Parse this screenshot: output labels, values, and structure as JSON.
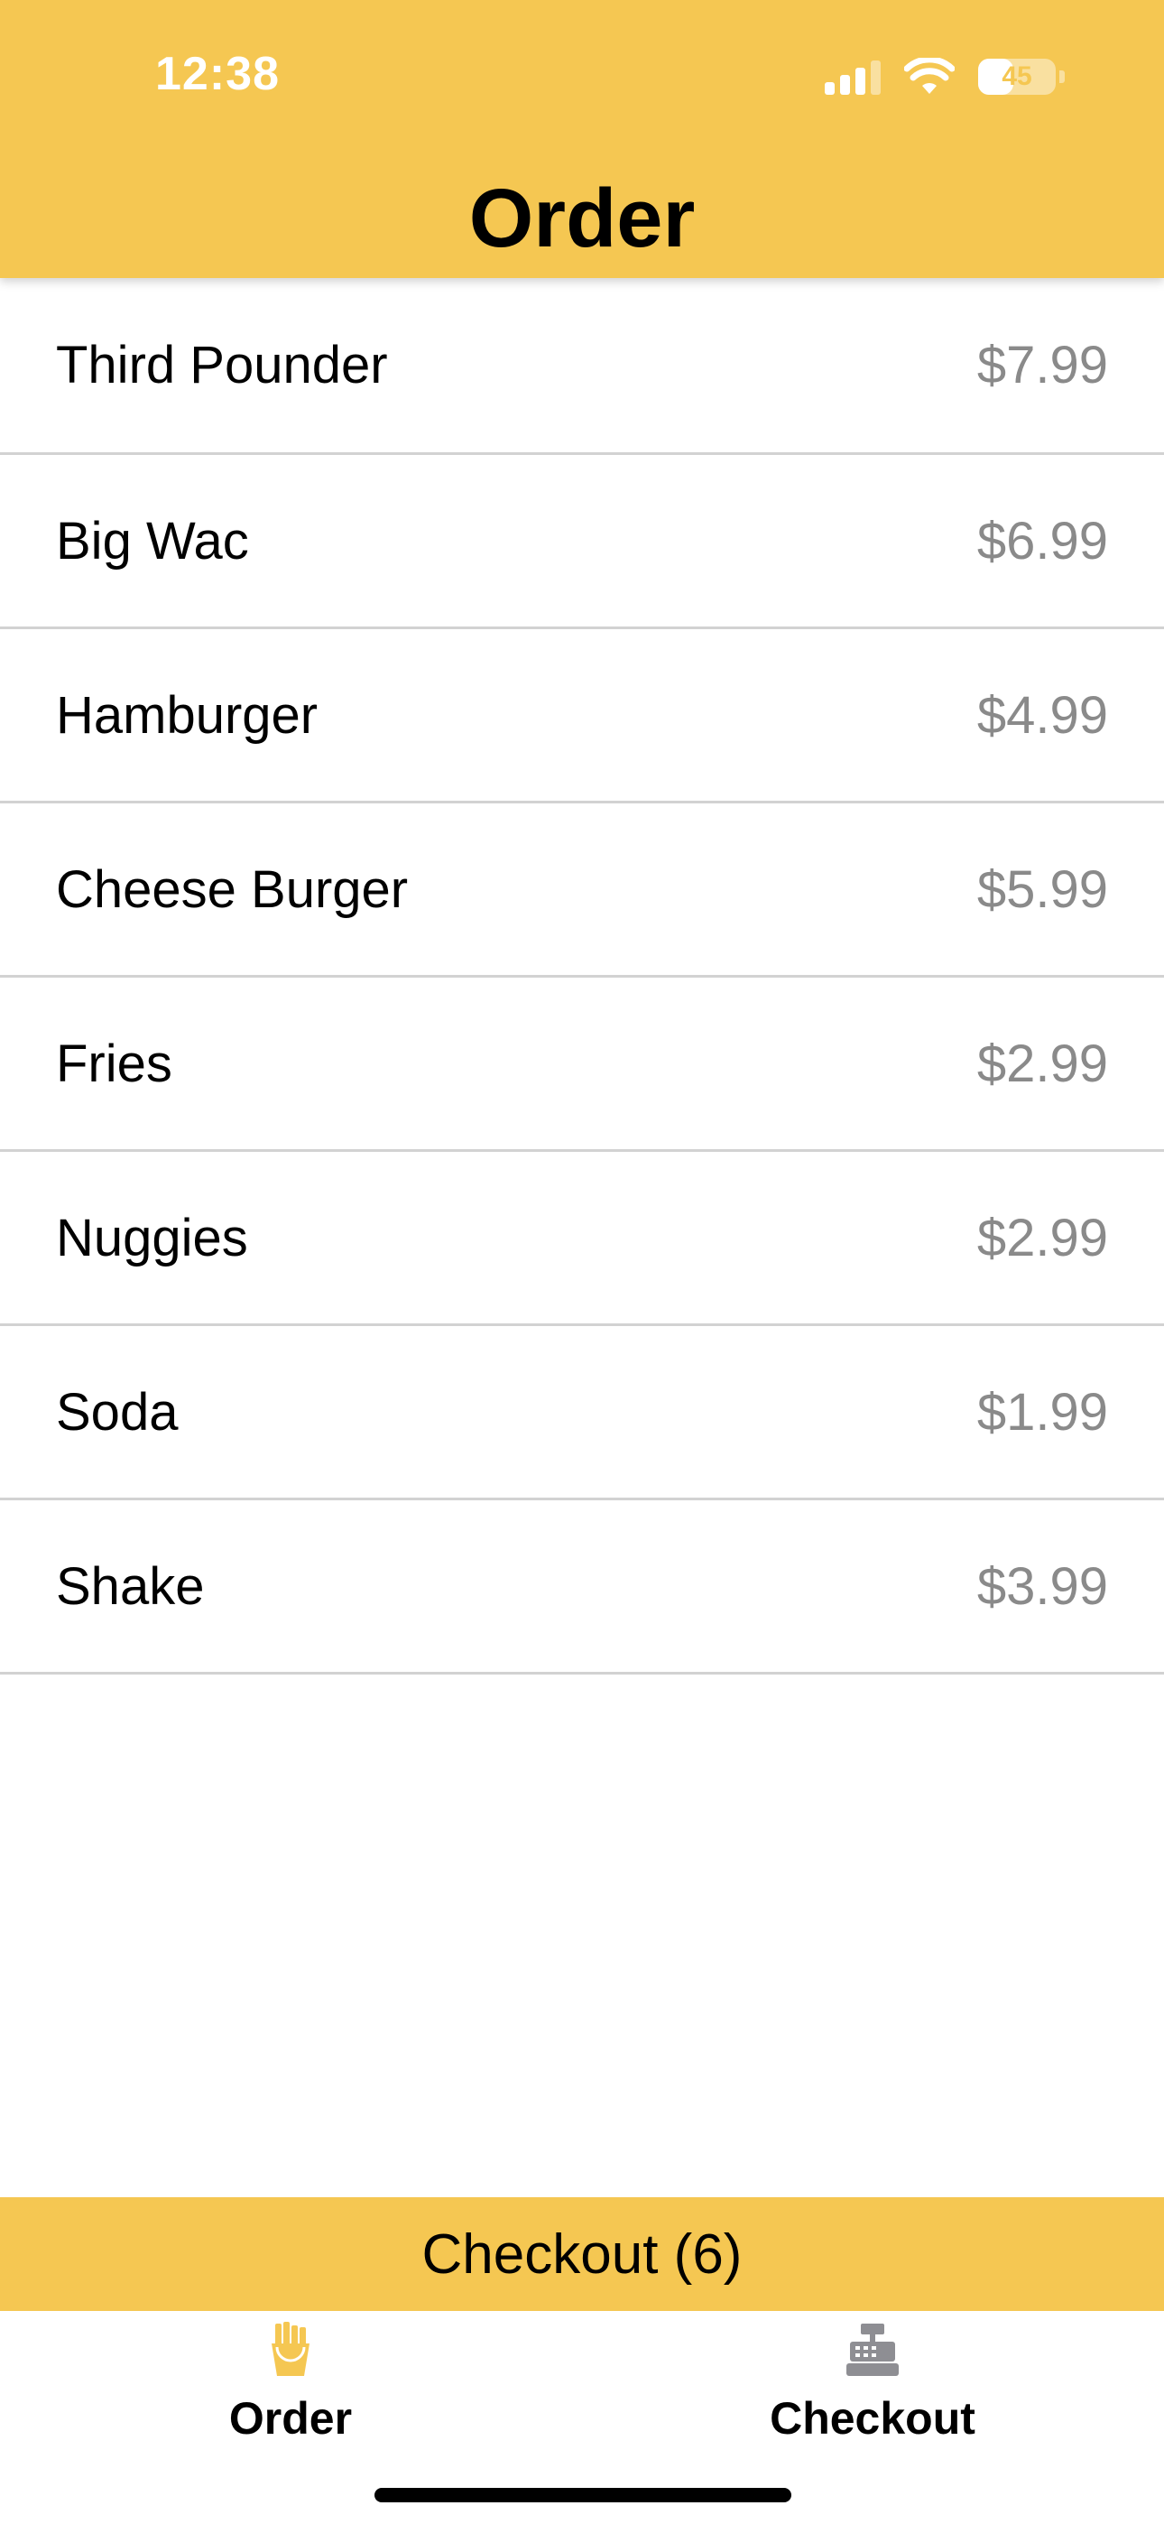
{
  "status_bar": {
    "time": "12:38",
    "battery_level": "45",
    "battery_fraction": 0.45,
    "signal_bars_active": 3
  },
  "header": {
    "title": "Order"
  },
  "menu": {
    "items": [
      {
        "name": "Third Pounder",
        "price": "$7.99"
      },
      {
        "name": "Big Wac",
        "price": "$6.99"
      },
      {
        "name": "Hamburger",
        "price": "$4.99"
      },
      {
        "name": "Cheese Burger",
        "price": "$5.99"
      },
      {
        "name": "Fries",
        "price": "$2.99"
      },
      {
        "name": "Nuggies",
        "price": "$2.99"
      },
      {
        "name": "Soda",
        "price": "$1.99"
      },
      {
        "name": "Shake",
        "price": "$3.99"
      }
    ]
  },
  "checkout_bar": {
    "label": "Checkout (6)"
  },
  "tab_bar": {
    "tabs": [
      {
        "label": "Order",
        "icon": "fries-icon",
        "active": true
      },
      {
        "label": "Checkout",
        "icon": "cash-register-icon",
        "active": false
      }
    ]
  },
  "colors": {
    "accent": "#F5C752",
    "price_text": "#8A8A8A",
    "divider": "#D2D2D2",
    "inactive_icon": "#8E8E93"
  }
}
